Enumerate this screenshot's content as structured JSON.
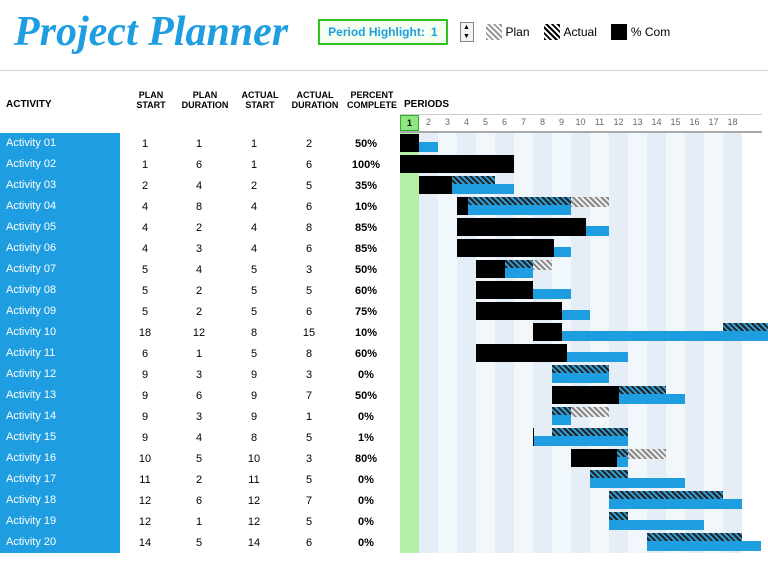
{
  "title": "Project Planner",
  "highlight": {
    "label": "Period Highlight:",
    "value": 1
  },
  "legend": {
    "plan": "Plan",
    "actual": "Actual",
    "complete": "% Com"
  },
  "columns": {
    "activity": "ACTIVITY",
    "plan_start": "PLAN START",
    "plan_duration": "PLAN DURATION",
    "actual_start": "ACTUAL START",
    "actual_duration": "ACTUAL DURATION",
    "percent_complete": "PERCENT COMPLETE",
    "periods": "PERIODS"
  },
  "period_count": 18,
  "chart_data": {
    "type": "gantt",
    "title": "Project Planner",
    "periods": [
      1,
      2,
      3,
      4,
      5,
      6,
      7,
      8,
      9,
      10,
      11,
      12,
      13,
      14,
      15,
      16,
      17,
      18
    ],
    "activities": [
      {
        "name": "Activity 01",
        "plan_start": 1,
        "plan_duration": 1,
        "actual_start": 1,
        "actual_duration": 2,
        "percent_complete": 50
      },
      {
        "name": "Activity 02",
        "plan_start": 1,
        "plan_duration": 6,
        "actual_start": 1,
        "actual_duration": 6,
        "percent_complete": 100
      },
      {
        "name": "Activity 03",
        "plan_start": 2,
        "plan_duration": 4,
        "actual_start": 2,
        "actual_duration": 5,
        "percent_complete": 35
      },
      {
        "name": "Activity 04",
        "plan_start": 4,
        "plan_duration": 8,
        "actual_start": 4,
        "actual_duration": 6,
        "percent_complete": 10
      },
      {
        "name": "Activity 05",
        "plan_start": 4,
        "plan_duration": 2,
        "actual_start": 4,
        "actual_duration": 8,
        "percent_complete": 85
      },
      {
        "name": "Activity 06",
        "plan_start": 4,
        "plan_duration": 3,
        "actual_start": 4,
        "actual_duration": 6,
        "percent_complete": 85
      },
      {
        "name": "Activity 07",
        "plan_start": 5,
        "plan_duration": 4,
        "actual_start": 5,
        "actual_duration": 3,
        "percent_complete": 50
      },
      {
        "name": "Activity 08",
        "plan_start": 5,
        "plan_duration": 2,
        "actual_start": 5,
        "actual_duration": 5,
        "percent_complete": 60
      },
      {
        "name": "Activity 09",
        "plan_start": 5,
        "plan_duration": 2,
        "actual_start": 5,
        "actual_duration": 6,
        "percent_complete": 75
      },
      {
        "name": "Activity 10",
        "plan_start": 18,
        "plan_duration": 12,
        "actual_start": 8,
        "actual_duration": 15,
        "percent_complete": 10
      },
      {
        "name": "Activity 11",
        "plan_start": 6,
        "plan_duration": 1,
        "actual_start": 5,
        "actual_duration": 8,
        "percent_complete": 60
      },
      {
        "name": "Activity 12",
        "plan_start": 9,
        "plan_duration": 3,
        "actual_start": 9,
        "actual_duration": 3,
        "percent_complete": 0
      },
      {
        "name": "Activity 13",
        "plan_start": 9,
        "plan_duration": 6,
        "actual_start": 9,
        "actual_duration": 7,
        "percent_complete": 50
      },
      {
        "name": "Activity 14",
        "plan_start": 9,
        "plan_duration": 3,
        "actual_start": 9,
        "actual_duration": 1,
        "percent_complete": 0
      },
      {
        "name": "Activity 15",
        "plan_start": 9,
        "plan_duration": 4,
        "actual_start": 8,
        "actual_duration": 5,
        "percent_complete": 1
      },
      {
        "name": "Activity 16",
        "plan_start": 10,
        "plan_duration": 5,
        "actual_start": 10,
        "actual_duration": 3,
        "percent_complete": 80
      },
      {
        "name": "Activity 17",
        "plan_start": 11,
        "plan_duration": 2,
        "actual_start": 11,
        "actual_duration": 5,
        "percent_complete": 0
      },
      {
        "name": "Activity 18",
        "plan_start": 12,
        "plan_duration": 6,
        "actual_start": 12,
        "actual_duration": 7,
        "percent_complete": 0
      },
      {
        "name": "Activity 19",
        "plan_start": 12,
        "plan_duration": 1,
        "actual_start": 12,
        "actual_duration": 5,
        "percent_complete": 0
      },
      {
        "name": "Activity 20",
        "plan_start": 14,
        "plan_duration": 5,
        "actual_start": 14,
        "actual_duration": 6,
        "percent_complete": 0
      }
    ]
  }
}
